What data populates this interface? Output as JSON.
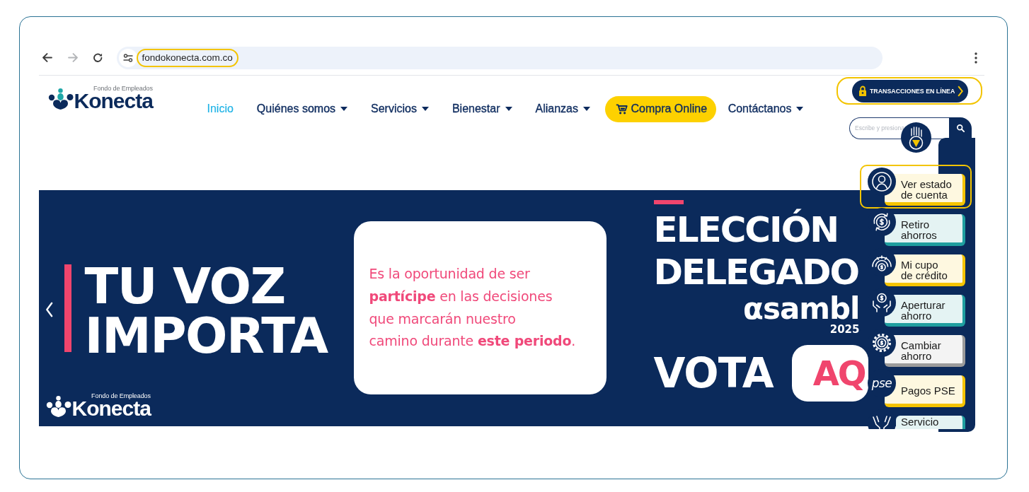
{
  "browser": {
    "url": "fondokonecta.com.co",
    "url_highlighted": true
  },
  "header": {
    "logo": {
      "tagline": "Fondo de Empleados",
      "name": "Konecta"
    },
    "nav": [
      {
        "label": "Inicio",
        "kind": "link",
        "selected": true,
        "dropdown": false
      },
      {
        "label": "Quiénes somos",
        "kind": "link",
        "selected": false,
        "dropdown": true
      },
      {
        "label": "Servicios",
        "kind": "link",
        "selected": false,
        "dropdown": true
      },
      {
        "label": "Bienestar",
        "kind": "link",
        "selected": false,
        "dropdown": true
      },
      {
        "label": "Alianzas",
        "kind": "link",
        "selected": false,
        "dropdown": true
      },
      {
        "label": "Compra Online",
        "kind": "button",
        "selected": false,
        "dropdown": false
      },
      {
        "label": "Contáctanos",
        "kind": "link",
        "selected": false,
        "dropdown": true
      }
    ],
    "transactions_button": {
      "label": "TRANSACCIONES EN LÍNEA",
      "highlighted": true
    },
    "search": {
      "placeholder": "Escribe y presiona"
    }
  },
  "banner": {
    "headline": [
      "TU VOZ",
      "IMPORTA"
    ],
    "logo": {
      "tagline": "Fondo de Empleados",
      "name": "Konecta"
    },
    "message": [
      "Es la oportunidad de ser",
      "**partícipe** en las decisiones",
      "que marcarán nuestro",
      "camino durante **este periodo**."
    ],
    "title": [
      "ELECCIÓN",
      "DELEGADO"
    ],
    "event": "αsambl",
    "year": "2025",
    "cta_text": "VOTA",
    "cta_button": "AQ"
  },
  "quick_panel": {
    "items": [
      {
        "label": "Ver estado de cuenta",
        "color": "#f5c400",
        "highlighted": true
      },
      {
        "label": "Retiro ahorros",
        "color": "#1f9e9f",
        "highlighted": false
      },
      {
        "label": "Mi cupo de crédito",
        "color": "#f5c400",
        "highlighted": false
      },
      {
        "label": "Aperturar ahorro",
        "color": "#1f9e9f",
        "highlighted": false
      },
      {
        "label": "Cambiar ahorro",
        "color": "#9b9b9b",
        "highlighted": false
      },
      {
        "label": "Pagos PSE",
        "color": "#f5c400",
        "highlighted": false,
        "logo_text": "pse"
      },
      {
        "label": "Servicio",
        "color": "#1f9e9f",
        "highlighted": false
      }
    ]
  }
}
